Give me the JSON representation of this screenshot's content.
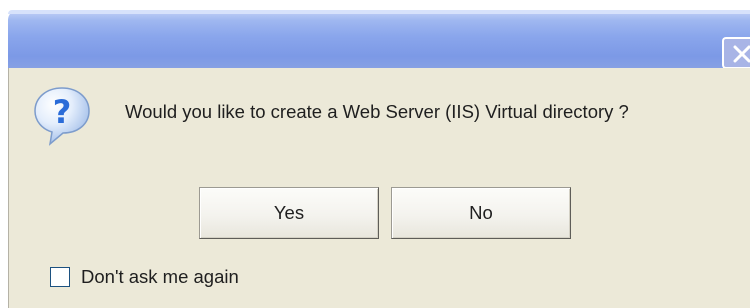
{
  "dialog": {
    "title": "",
    "message": "Would you like to create a Web Server (IIS) Virtual directory ?",
    "icon": "question-icon",
    "buttons": {
      "yes_label": "Yes",
      "no_label": "No"
    },
    "checkbox": {
      "label": "Don't ask me again",
      "checked": false
    }
  },
  "colors": {
    "titlebar": "#8aa6ec",
    "close_button": "#a8b4e6",
    "dialog_body": "#ece9d8",
    "icon_blue": "#2b6cd8"
  }
}
